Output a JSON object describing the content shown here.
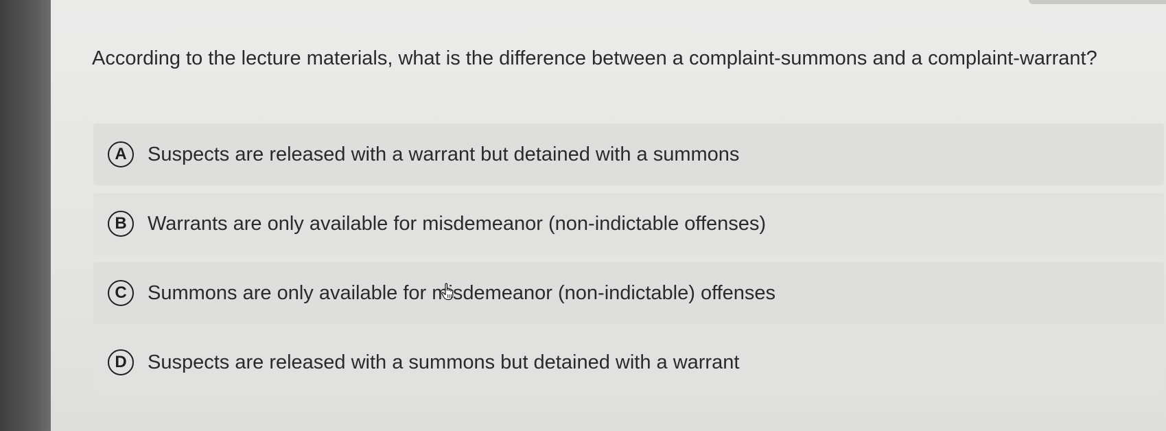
{
  "question": {
    "text": "According to the lecture materials, what is the difference between a complaint-summons and a complaint-warrant?"
  },
  "options": [
    {
      "letter": "A",
      "text": "Suspects are released with a warrant but detained with a summons"
    },
    {
      "letter": "B",
      "text": "Warrants are only available for misdemeanor (non-indictable offenses)"
    },
    {
      "letter": "C",
      "text": "Summons are only available for misdemeanor (non-indictable) offenses"
    },
    {
      "letter": "D",
      "text": "Suspects are released with a summons but detained with a warrant"
    }
  ],
  "colors": {
    "text": "#2a2a2a",
    "option_background": "#dededc",
    "page_background": "#e8e8e6"
  },
  "icons": {
    "cursor": "hand-pointer-icon"
  }
}
